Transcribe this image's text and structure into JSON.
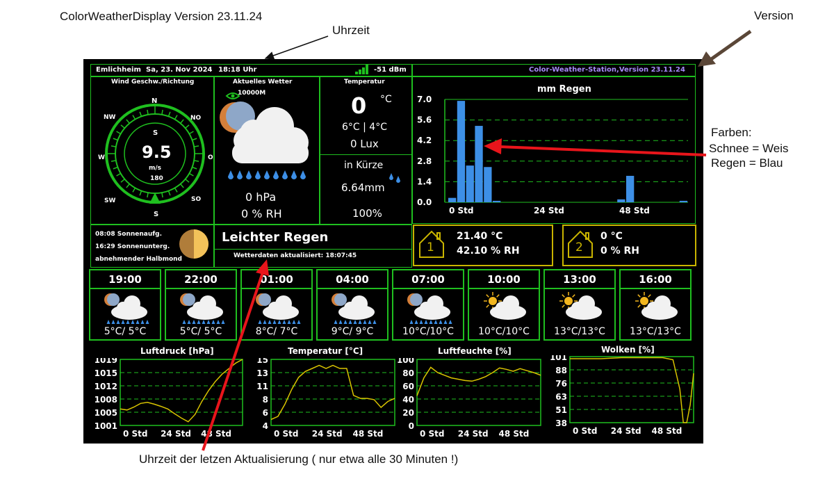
{
  "annotations": {
    "app_version_title": "ColorWeatherDisplay Version 23.11.24",
    "clock_label": "Uhrzeit",
    "version_label": "Version",
    "colors_heading": "Farben:",
    "colors_snow": "Schnee = Weis",
    "colors_rain": "Regen = Blau",
    "update_time_note": "Uhrzeit der letzen Aktualisierung  ( nur etwa alle 30 Minuten !)"
  },
  "colors": {
    "accent_green": "#1fbf1f",
    "text_purple": "#a78bfa",
    "rain_blue": "#3d8fe6",
    "snow_white": "#f1f1f1",
    "arrow_red": "#e8151b",
    "arrow_brown": "#5a4637",
    "indoor_yellow": "#c9b400"
  },
  "header": {
    "location": "Emlichheim",
    "date": "Sa, 23. Nov 2024",
    "time": "18:18 Uhr",
    "signal": "-51 dBm",
    "station_version": "Color-Weather-Station,Version 23.11.24"
  },
  "wind": {
    "title": "Wind Geschw./Richtung",
    "n": "N",
    "ne": "NO",
    "e": "O",
    "se": "SO",
    "s": "S",
    "sw": "SW",
    "w": "W",
    "nw": "NW",
    "dir": "S",
    "speed": "9.5",
    "unit": "m/s",
    "degrees": "180"
  },
  "current": {
    "title": "Aktuelles Wetter",
    "visibility": "10000M",
    "pressure": "0 hPa",
    "humidity": "0 % RH"
  },
  "temperature": {
    "title": "Temperatur",
    "value": "0",
    "unit": "°C",
    "minmax": "6°C | 4°C",
    "lux": "0 Lux",
    "soon_label": "in Kürze",
    "rain": "6.64mm",
    "probability": "100%"
  },
  "sun": {
    "sunrise": "08:08 Sonnenaufg.",
    "sunset": "16:29 Sonnenunterg.",
    "moon": "abnehmender Halbmond"
  },
  "condition": {
    "text": "Leichter Regen",
    "updated": "Wetterdaten aktualisiert: 18:07:45"
  },
  "rain_chart": {
    "title": "mm Regen",
    "y_ticks": [
      "7.0",
      "5.6",
      "4.2",
      "2.8",
      "1.4",
      "0.0"
    ],
    "x_ticks": [
      "0 Std",
      "24 Std",
      "48 Std"
    ]
  },
  "indoor": [
    {
      "num": "1",
      "temp": "21.40 °C",
      "hum": "42.10 % RH"
    },
    {
      "num": "2",
      "temp": "0 °C",
      "hum": "0 % RH"
    }
  ],
  "forecast": [
    {
      "time": "19:00",
      "temp": "5°C/ 5°C",
      "icon": "rain"
    },
    {
      "time": "22:00",
      "temp": "5°C/ 5°C",
      "icon": "rain"
    },
    {
      "time": "01:00",
      "temp": "8°C/ 7°C",
      "icon": "rain"
    },
    {
      "time": "04:00",
      "temp": "9°C/ 9°C",
      "icon": "rain"
    },
    {
      "time": "07:00",
      "temp": "10°C/10°C",
      "icon": "rain"
    },
    {
      "time": "10:00",
      "temp": "10°C/10°C",
      "icon": "sun-cloud"
    },
    {
      "time": "13:00",
      "temp": "13°C/13°C",
      "icon": "sun-cloud"
    },
    {
      "time": "16:00",
      "temp": "13°C/13°C",
      "icon": "sun-cloud"
    }
  ],
  "mini_titles": {
    "pressure": "Luftdruck [hPa]",
    "temperature": "Temperatur [°C]",
    "humidity": "Luftfeuchte [%]",
    "clouds": "Wolken [%]"
  },
  "chart_data": [
    {
      "type": "bar",
      "title": "mm Regen",
      "xlabel": "",
      "ylabel": "",
      "ylim": [
        0,
        7
      ],
      "x_ticks": [
        "0 Std",
        "24 Std",
        "48 Std"
      ],
      "grid": true,
      "x": [
        0,
        1,
        2,
        3,
        4,
        5,
        19,
        20,
        26
      ],
      "values": [
        0.3,
        6.9,
        2.5,
        5.2,
        2.4,
        0.1,
        0.2,
        1.8,
        0.1
      ]
    },
    {
      "type": "line",
      "title": "Luftdruck [hPa]",
      "ylim": [
        1001,
        1019
      ],
      "y_ticks": [
        "1019",
        "1015",
        "1012",
        "1008",
        "1005",
        "1001"
      ],
      "x_ticks": [
        "0 Std",
        "24 Std",
        "48 Std"
      ],
      "grid": true,
      "x": [
        0,
        4,
        8,
        12,
        16,
        20,
        24,
        28,
        32,
        36,
        40,
        44,
        48,
        52,
        56,
        60,
        64,
        68,
        72
      ],
      "values": [
        1005.5,
        1005.2,
        1006.0,
        1007.0,
        1007.3,
        1006.8,
        1006.2,
        1005.5,
        1004.2,
        1003.0,
        1002.0,
        1004.0,
        1007.5,
        1010.5,
        1013.0,
        1015.0,
        1016.5,
        1018.0,
        1019.0
      ]
    },
    {
      "type": "line",
      "title": "Temperatur [°C]",
      "ylim": [
        4,
        15
      ],
      "y_ticks": [
        "15",
        "13",
        "11",
        "8",
        "6",
        "4"
      ],
      "x_ticks": [
        "0 Std",
        "24 Std",
        "48 Std"
      ],
      "grid": true,
      "x": [
        0,
        4,
        8,
        12,
        16,
        20,
        24,
        28,
        32,
        36,
        40,
        44,
        48,
        52,
        56,
        60,
        64,
        68,
        72
      ],
      "values": [
        5,
        5.5,
        7.5,
        10,
        12,
        13,
        13.5,
        14,
        13.5,
        14,
        13.5,
        13.5,
        9,
        8.5,
        8.5,
        8.3,
        7,
        8,
        8.5
      ]
    },
    {
      "type": "line",
      "title": "Luftfeuchte [%]",
      "ylim": [
        0,
        100
      ],
      "y_ticks": [
        "100",
        "80",
        "60",
        "40",
        "20",
        "0"
      ],
      "x_ticks": [
        "0 Std",
        "24 Std",
        "48 Std"
      ],
      "grid": true,
      "x": [
        0,
        4,
        8,
        12,
        16,
        20,
        24,
        28,
        32,
        36,
        40,
        44,
        48,
        52,
        56,
        60,
        64,
        68,
        72
      ],
      "values": [
        45,
        72,
        88,
        80,
        76,
        72,
        70,
        68,
        67,
        70,
        74,
        80,
        87,
        85,
        82,
        86,
        83,
        80,
        76
      ]
    },
    {
      "type": "line",
      "title": "Wolken [%]",
      "ylim": [
        38,
        101
      ],
      "y_ticks": [
        "101",
        "88",
        "76",
        "63",
        "51",
        "38"
      ],
      "x_ticks": [
        "0 Std",
        "24 Std",
        "48 Std"
      ],
      "grid": true,
      "x": [
        0,
        6,
        12,
        18,
        24,
        30,
        36,
        42,
        48,
        54,
        60,
        64,
        66,
        68,
        70,
        72
      ],
      "values": [
        99,
        99,
        99,
        99,
        99.5,
        100,
        100,
        100,
        100,
        100,
        98,
        70,
        38,
        38,
        55,
        85
      ]
    }
  ]
}
